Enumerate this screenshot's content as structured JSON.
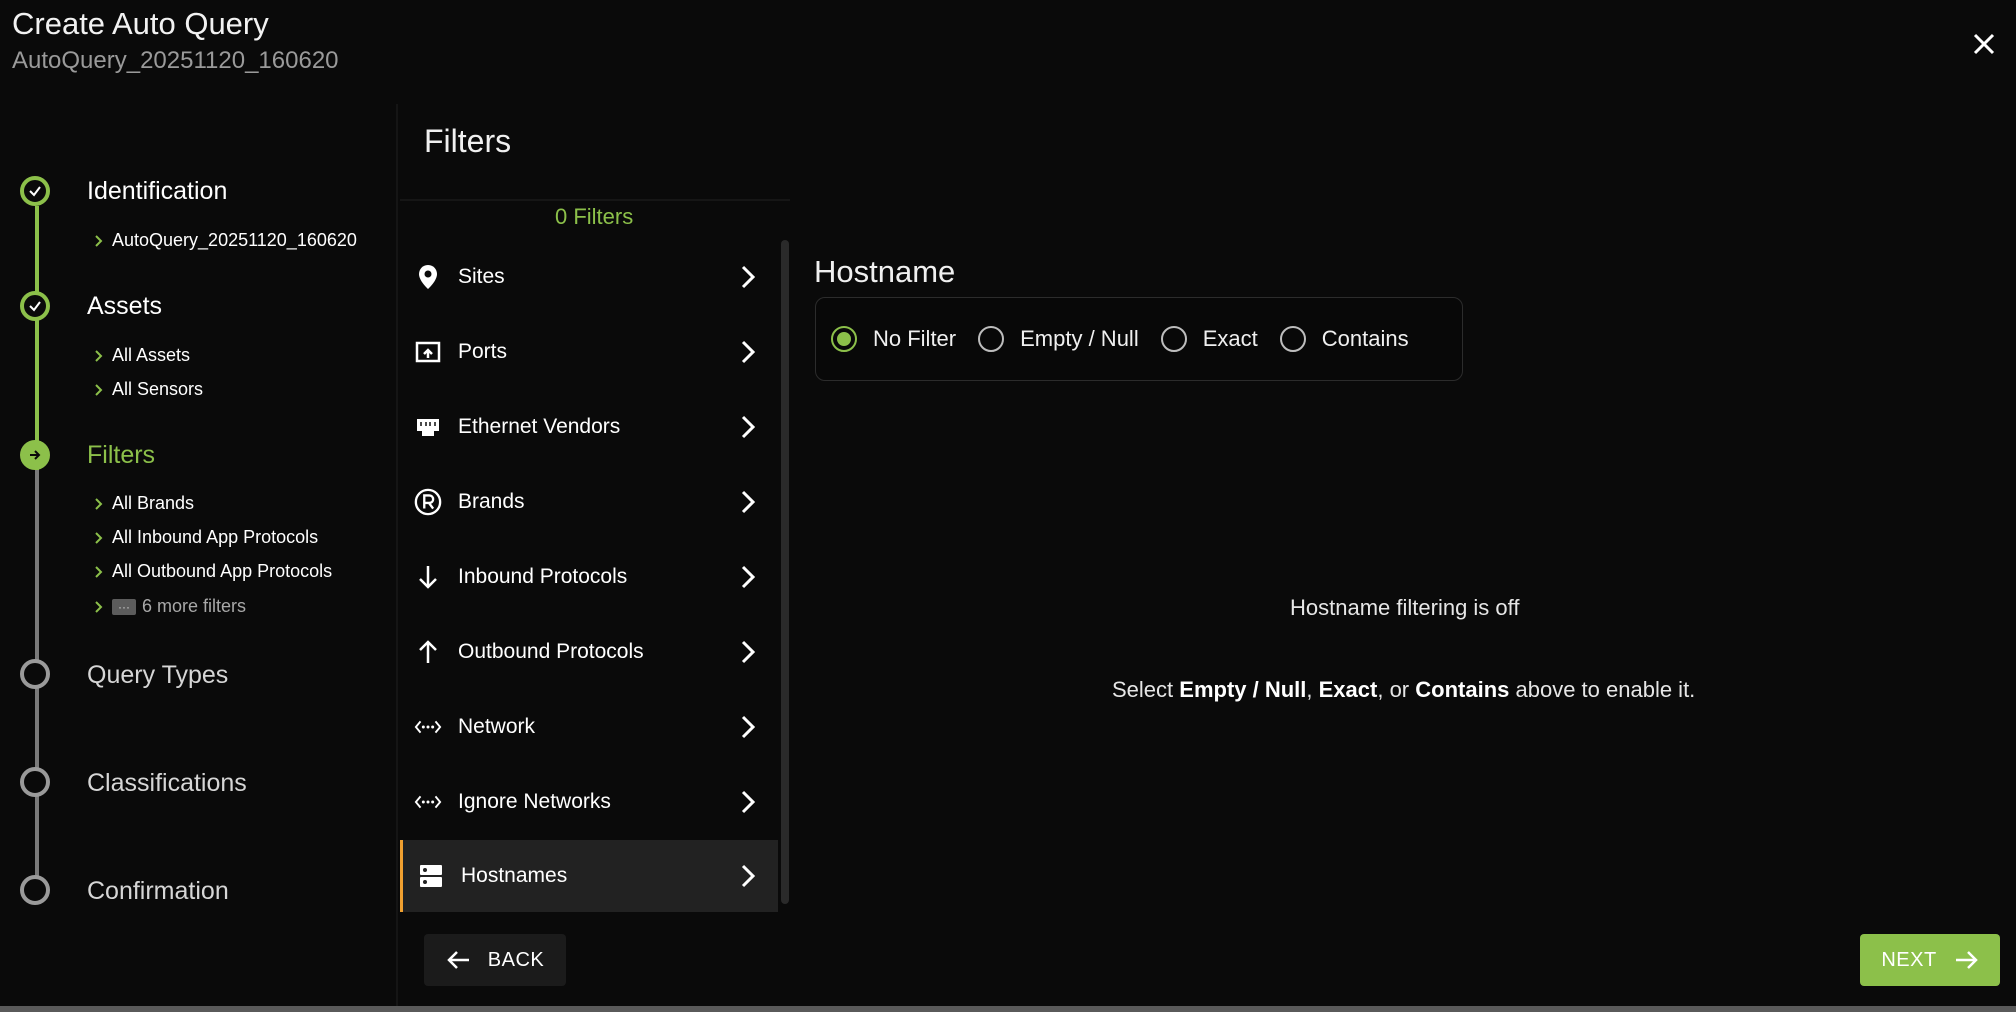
{
  "header": {
    "title": "Create Auto Query",
    "subtitle": "AutoQuery_20251120_160620",
    "close_icon": "close-icon"
  },
  "stepper": {
    "steps": [
      {
        "label": "Identification",
        "state": "done"
      },
      {
        "label": "Assets",
        "state": "done"
      },
      {
        "label": "Filters",
        "state": "current"
      },
      {
        "label": "Query Types",
        "state": "todo"
      },
      {
        "label": "Classifications",
        "state": "todo"
      },
      {
        "label": "Confirmation",
        "state": "todo"
      }
    ],
    "identification_items": [
      "AutoQuery_20251120_160620"
    ],
    "assets_items": [
      "All Assets",
      "All Sensors"
    ],
    "filters_items": [
      "All Brands",
      "All Inbound App Protocols",
      "All Outbound App Protocols"
    ],
    "filters_more": "6 more filters",
    "more_tag_text": "···",
    "colors": {
      "accent": "#8cc04a",
      "todo": "#9a9a9a"
    }
  },
  "filters_panel": {
    "heading": "Filters",
    "count": "0 Filters",
    "items": [
      {
        "label": "Sites",
        "icon": "map-pin-icon"
      },
      {
        "label": "Ports",
        "icon": "port-icon"
      },
      {
        "label": "Ethernet Vendors",
        "icon": "ethernet-icon"
      },
      {
        "label": "Brands",
        "icon": "registered-icon"
      },
      {
        "label": "Inbound Protocols",
        "icon": "arrow-down-icon"
      },
      {
        "label": "Outbound Protocols",
        "icon": "arrow-up-icon"
      },
      {
        "label": "Network",
        "icon": "network-icon"
      },
      {
        "label": "Ignore Networks",
        "icon": "network-icon"
      },
      {
        "label": "Hostnames",
        "icon": "server-icon",
        "selected": true
      }
    ],
    "selected_color": "#f0a030"
  },
  "detail": {
    "title": "Hostname",
    "options": [
      {
        "label": "No Filter",
        "checked": true
      },
      {
        "label": "Empty / Null",
        "checked": false
      },
      {
        "label": "Exact",
        "checked": false
      },
      {
        "label": "Contains",
        "checked": false
      }
    ],
    "off_message": "Hostname filtering is off",
    "hint": {
      "prefix": "Select ",
      "opt1": "Empty / Null",
      "sep1": ", ",
      "opt2": "Exact",
      "sep2": ", or ",
      "opt3": "Contains",
      "suffix": " above to enable it."
    }
  },
  "footer": {
    "back_label": "BACK",
    "next_label": "NEXT"
  }
}
